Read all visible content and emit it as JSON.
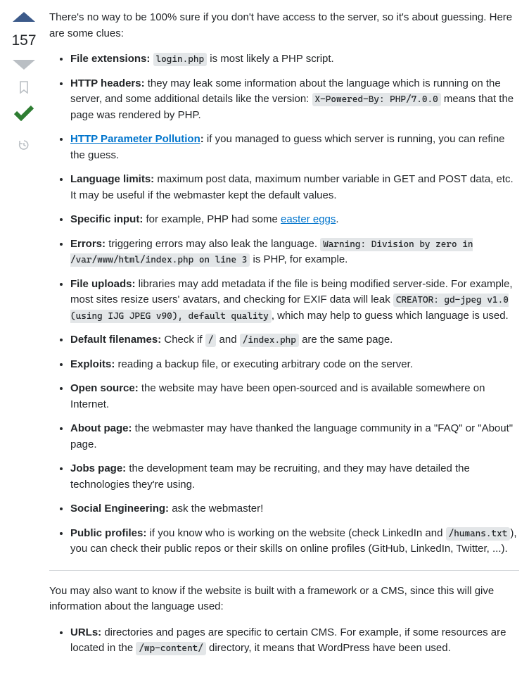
{
  "vote": {
    "count": "157"
  },
  "icons": {
    "upvote": "upvote-icon",
    "downvote": "downvote-icon",
    "bookmark": "bookmark-icon",
    "accepted": "accepted-icon",
    "history": "history-icon"
  },
  "colors": {
    "upvote_active": "#3c5a8a",
    "downvote_inactive": "#babfc4",
    "accepted": "#2e7d32",
    "muted": "#babfc4"
  },
  "intro": "There's no way to be 100% sure if you don't have access to the server, so it's about guessing. Here are some clues:",
  "clues": [
    {
      "label": "File extensions:",
      "pre": " ",
      "code1": "login.php",
      "post1": " is most likely a PHP script."
    },
    {
      "label": "HTTP headers:",
      "pre": " they may leak some information about the language which is running on the server, and some additional details like the version: ",
      "code1": "X-Powered-By: PHP/7.0.0",
      "post1": " means that the page was rendered by PHP."
    },
    {
      "link": "HTTP Parameter Pollution",
      "label_after_link": ":",
      "pre": " if you managed to guess which server is running, you can refine the guess."
    },
    {
      "label": "Language limits:",
      "pre": " maximum post data, maximum number variable in GET and POST data, etc. It may be useful if the webmaster kept the default values."
    },
    {
      "label": "Specific input:",
      "pre": " for example, PHP had some ",
      "link_mid": "easter eggs",
      "post_link": "."
    },
    {
      "label": "Errors:",
      "pre": " triggering errors may also leak the language. ",
      "code1": "Warning: Division by zero in /var/www/html/index.php on line 3",
      "post1": " is PHP, for example."
    },
    {
      "label": "File uploads:",
      "pre": " libraries may add metadata if the file is being modified server-side. For example, most sites resize users' avatars, and checking for EXIF data will leak ",
      "code1": "CREATOR: gd-jpeg v1.0 (using IJG JPEG v90), default quality",
      "post1": ", which may help to guess which language is used."
    },
    {
      "label": "Default filenames:",
      "pre": " Check if ",
      "code1": "/",
      "mid1": " and ",
      "code2": "/index.php",
      "post2": " are the same page."
    },
    {
      "label": "Exploits:",
      "pre": " reading a backup file, or executing arbitrary code on the server."
    },
    {
      "label": "Open source:",
      "pre": " the website may have been open-sourced and is available somewhere on Internet."
    },
    {
      "label": "About page:",
      "pre": " the webmaster may have thanked the language community in a \"FAQ\" or \"About\" page."
    },
    {
      "label": "Jobs page:",
      "pre": " the development team may be recruiting, and they may have detailed the technologies they're using."
    },
    {
      "label": "Social Engineering:",
      "pre": " ask the webmaster!"
    },
    {
      "label": "Public profiles:",
      "pre": " if you know who is working on the website (check LinkedIn and ",
      "code1": "/humans.txt",
      "post1": "), you can check their public repos or their skills on online profiles (GitHub, LinkedIn, Twitter, ...)."
    }
  ],
  "section2_intro": "You may also want to know if the website is built with a framework or a CMS, since this will give information about the language used:",
  "section2_items": [
    {
      "label": "URLs:",
      "pre": " directories and pages are specific to certain CMS. For example, if some resources are located in the ",
      "code1": "/wp-content/",
      "post1": " directory, it means that WordPress have been used."
    }
  ]
}
